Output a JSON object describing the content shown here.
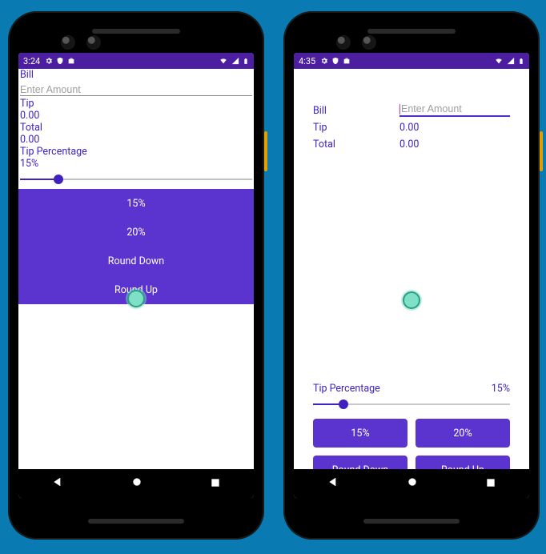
{
  "left": {
    "status": {
      "clock": "3:24"
    },
    "bill_label": "Bill",
    "bill_placeholder": "Enter Amount",
    "tip_label": "Tip",
    "tip_value": "0.00",
    "total_label": "Total",
    "total_value": "0.00",
    "tip_pct_label": "Tip Percentage",
    "tip_pct_value": "15%",
    "buttons": {
      "p15": "15%",
      "p20": "20%",
      "round_down": "Round Down",
      "round_up": "Round Up"
    }
  },
  "right": {
    "status": {
      "clock": "4:35"
    },
    "bill_label": "Bill",
    "bill_placeholder": "Enter Amount",
    "tip_label": "Tip",
    "tip_value": "0.00",
    "total_label": "Total",
    "total_value": "0.00",
    "tip_pct_label": "Tip Percentage",
    "tip_pct_value": "15%",
    "buttons": {
      "p15": "15%",
      "p20": "20%",
      "round_down": "Round Down",
      "round_up": "Round Up"
    }
  }
}
